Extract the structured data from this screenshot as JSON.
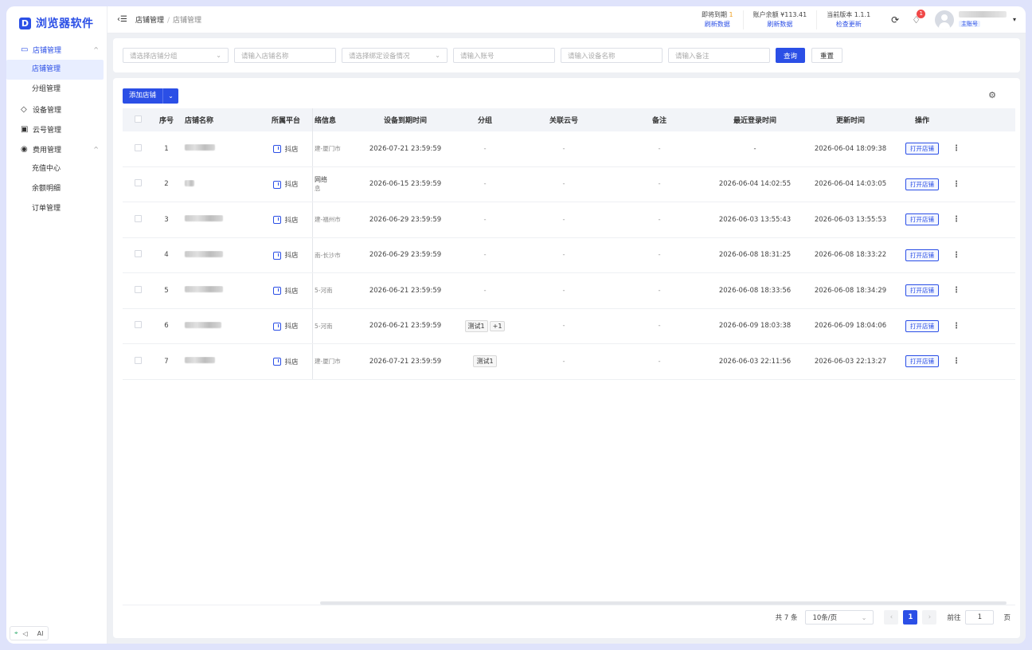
{
  "app": {
    "logo_letter": "D",
    "title": "浏览器软件"
  },
  "sidebar": {
    "groups": [
      {
        "label": "店铺管理",
        "icon": "store-icon",
        "expanded": true,
        "items": [
          {
            "label": "店铺管理"
          },
          {
            "label": "分组管理"
          }
        ]
      },
      {
        "label": "设备管理",
        "icon": "device-icon"
      },
      {
        "label": "云号管理",
        "icon": "cloud-icon"
      },
      {
        "label": "费用管理",
        "icon": "fee-icon",
        "expanded": true,
        "items": [
          {
            "label": "充值中心"
          },
          {
            "label": "余额明细"
          },
          {
            "label": "订单管理"
          }
        ]
      }
    ],
    "footer": {
      "a": "⌖",
      "b": "◁",
      "c": "",
      "d": "AI"
    }
  },
  "header": {
    "breadcrumb": [
      "店铺管理",
      "店铺管理"
    ],
    "expiring": {
      "label": "即将到期",
      "count": "1",
      "link": "刷新数据"
    },
    "balance": {
      "label": "账户余额",
      "value": "¥113.41",
      "link": "刷新数据"
    },
    "version": {
      "label": "当前版本",
      "value": "1.1.1",
      "link": "检查更新"
    },
    "notify_count": "1",
    "user_tag": "主账号"
  },
  "filters": {
    "group_placeholder": "请选择店铺分组",
    "name_placeholder": "请输入店铺名称",
    "device_state_placeholder": "请选择绑定设备情况",
    "account_placeholder": "请输入账号",
    "device_name_placeholder": "请输入设备名称",
    "note_placeholder": "请输入备注",
    "search_label": "查询",
    "reset_label": "重置"
  },
  "toolbar": {
    "add_label": "添加店铺"
  },
  "table": {
    "columns": [
      "序号",
      "店铺名称",
      "所属平台",
      "络信息",
      "设备到期时间",
      "分组",
      "关联云号",
      "备注",
      "最近登录时间",
      "更新时间",
      "操作"
    ],
    "open_label": "打开店铺",
    "rows": [
      {
        "idx": "1",
        "platform": "抖店",
        "ip_top": "",
        "ip_bot": "建-厦门市",
        "expire": "2026-07-21 23:59:59",
        "group": "-",
        "cloud": "-",
        "note": "-",
        "login": "-",
        "updated": "2026-06-04 18:09:38"
      },
      {
        "idx": "2",
        "platform": "抖店",
        "ip_top": "网络",
        "ip_bot": "息",
        "expire": "2026-06-15 23:59:59",
        "group": "-",
        "cloud": "-",
        "note": "-",
        "login": "2026-06-04 14:02:55",
        "updated": "2026-06-04 14:03:05"
      },
      {
        "idx": "3",
        "platform": "抖店",
        "ip_top": "",
        "ip_bot": "建-福州市",
        "expire": "2026-06-29 23:59:59",
        "group": "-",
        "cloud": "-",
        "note": "-",
        "login": "2026-06-03 13:55:43",
        "updated": "2026-06-03 13:55:53"
      },
      {
        "idx": "4",
        "platform": "抖店",
        "ip_top": "",
        "ip_bot": "南-长沙市",
        "expire": "2026-06-29 23:59:59",
        "group": "-",
        "cloud": "-",
        "note": "-",
        "login": "2026-06-08 18:31:25",
        "updated": "2026-06-08 18:33:22"
      },
      {
        "idx": "5",
        "platform": "抖店",
        "ip_top": "",
        "ip_bot": "5-河南",
        "expire": "2026-06-21 23:59:59",
        "group": "-",
        "cloud": "-",
        "note": "-",
        "login": "2026-06-08 18:33:56",
        "updated": "2026-06-08 18:34:29"
      },
      {
        "idx": "6",
        "platform": "抖店",
        "ip_top": "",
        "ip_bot": "5-河南",
        "expire": "2026-06-21 23:59:59",
        "group_tags": [
          "测试1",
          "+1"
        ],
        "cloud": "-",
        "note": "-",
        "login": "2026-06-09 18:03:38",
        "updated": "2026-06-09 18:04:06"
      },
      {
        "idx": "7",
        "platform": "抖店",
        "ip_top": "",
        "ip_bot": "建-厦门市",
        "expire": "2026-07-21 23:59:59",
        "group_tags": [
          "测试1"
        ],
        "cloud": "-",
        "note": "-",
        "login": "2026-06-03 22:11:56",
        "updated": "2026-06-03 22:13:27"
      }
    ]
  },
  "pager": {
    "total_label": "共 7 条",
    "page_size": "10条/页",
    "current": "1",
    "goto_label": "前往",
    "goto_value": "1",
    "page_unit": "页"
  }
}
